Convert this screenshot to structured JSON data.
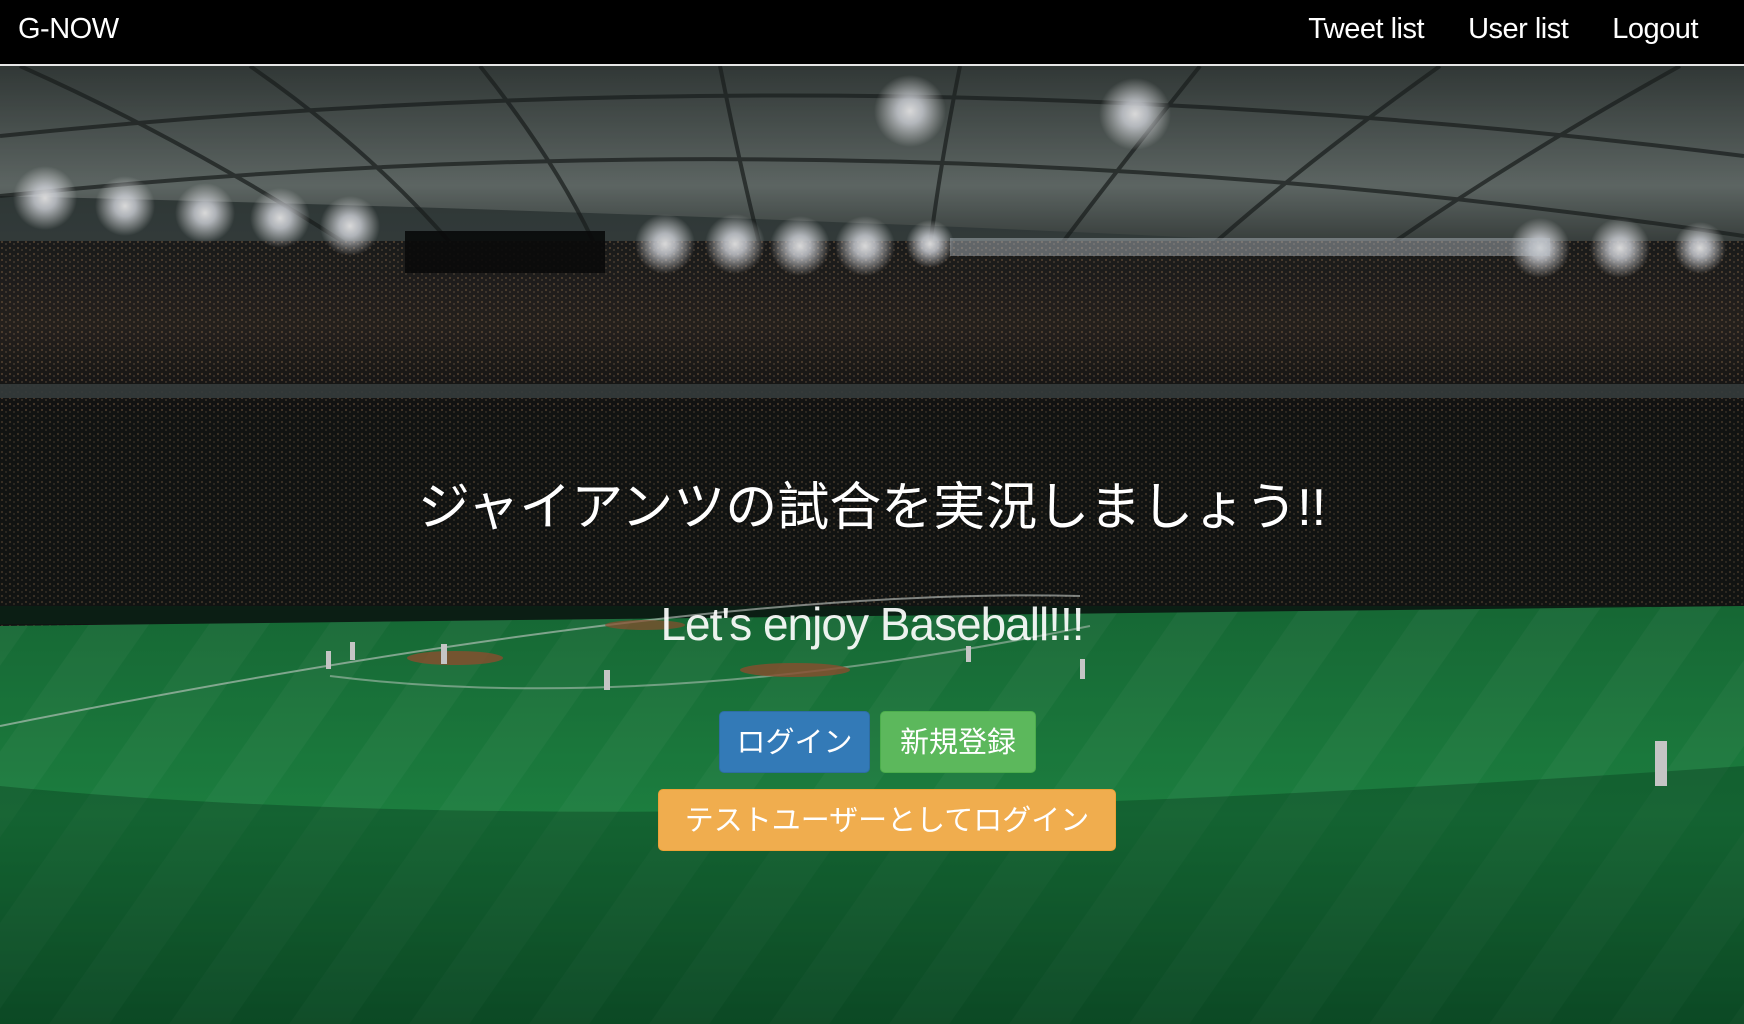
{
  "navbar": {
    "brand": "G-NOW",
    "links": [
      "Tweet list",
      "User list",
      "Logout"
    ]
  },
  "hero": {
    "headline": "ジャイアンツの試合を実況しましょう!!",
    "subline": "Let's enjoy Baseball!!!",
    "buttons": {
      "login": "ログイン",
      "signup": "新規登録",
      "test_login": "テストユーザーとしてログイン"
    }
  },
  "colors": {
    "navbar_bg": "#000000",
    "login": "#337ab7",
    "signup": "#5cb85c",
    "test_login": "#f0ad4e"
  }
}
